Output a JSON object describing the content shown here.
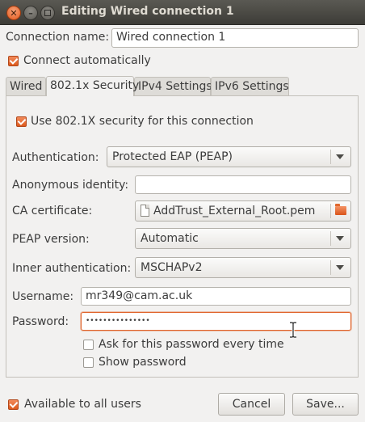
{
  "window": {
    "title": "Editing Wired connection 1"
  },
  "connection_name": {
    "label": "Connection name:",
    "value": "Wired connection 1"
  },
  "connect_automatically": {
    "label": "Connect automatically",
    "checked": true
  },
  "tabs": [
    {
      "label": "Wired",
      "active": false
    },
    {
      "label": "802.1x Security",
      "active": true
    },
    {
      "label": "IPv4 Settings",
      "active": false
    },
    {
      "label": "IPv6 Settings",
      "active": false
    }
  ],
  "security": {
    "use_8021x": {
      "label": "Use 802.1X security for this connection",
      "checked": true
    },
    "authentication": {
      "label": "Authentication:",
      "value": "Protected EAP (PEAP)"
    },
    "anonymous_identity": {
      "label": "Anonymous identity:",
      "value": ""
    },
    "ca_certificate": {
      "label": "CA certificate:",
      "value": "AddTrust_External_Root.pem"
    },
    "peap_version": {
      "label": "PEAP version:",
      "value": "Automatic"
    },
    "inner_auth": {
      "label": "Inner authentication:",
      "value": "MSCHAPv2"
    },
    "username": {
      "label": "Username:",
      "value": "mr349@cam.ac.uk"
    },
    "password": {
      "label": "Password:",
      "value": "•••••••••••••••"
    },
    "ask_password": {
      "label": "Ask for this password every time",
      "checked": false
    },
    "show_password": {
      "label": "Show password",
      "checked": false
    }
  },
  "footer": {
    "available_all_users": {
      "label": "Available to all users",
      "checked": true
    },
    "cancel_label": "Cancel",
    "save_label": "Save..."
  },
  "colors": {
    "accent": "#dd5a1c",
    "titlebar": "#3d3c37",
    "background": "#f2f1f0"
  },
  "icons": [
    "close-icon",
    "minimize-icon",
    "maximize-icon",
    "document-icon",
    "folder-icon",
    "mouse-cursor-icon"
  ]
}
